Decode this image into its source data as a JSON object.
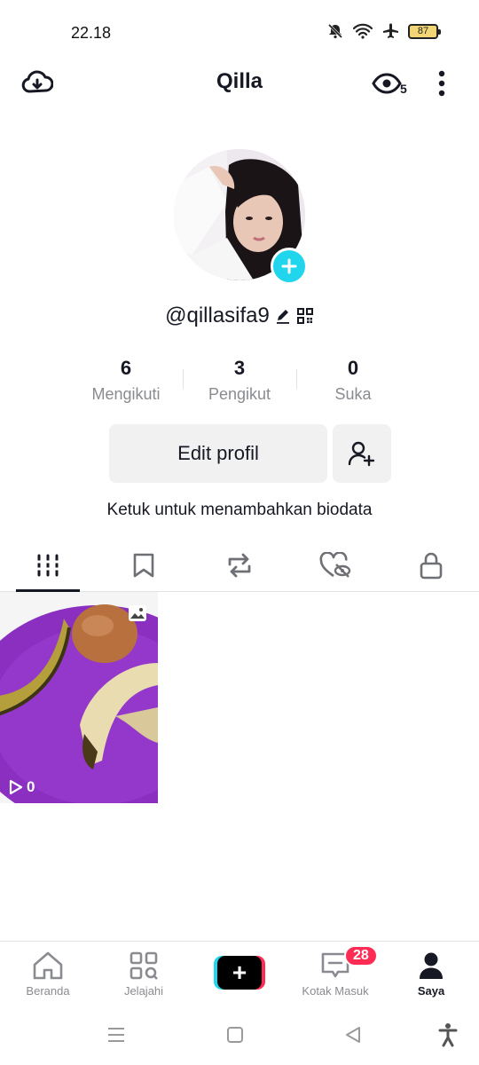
{
  "status_bar": {
    "time": "22.18",
    "battery": "87"
  },
  "header": {
    "title": "Qilla",
    "views_count": "5"
  },
  "profile": {
    "username": "@qillasifa9",
    "stats": [
      {
        "value": "6",
        "label": "Mengikuti"
      },
      {
        "value": "3",
        "label": "Pengikut"
      },
      {
        "value": "0",
        "label": "Suka"
      }
    ],
    "edit_label": "Edit profil",
    "bio_prompt": "Ketuk untuk menambahkan biodata"
  },
  "tabs": [
    "videos-grid-icon",
    "bookmark-icon",
    "repost-icon",
    "liked-hidden-icon",
    "lock-icon"
  ],
  "videos": [
    {
      "views": "0"
    }
  ],
  "bottom_nav": {
    "home": "Beranda",
    "explore": "Jelajahi",
    "inbox": "Kotak Masuk",
    "inbox_badge": "28",
    "profile": "Saya"
  },
  "colors": {
    "accent_cyan": "#20d5ec",
    "accent_red": "#fe2c55",
    "text": "#161823",
    "muted": "#8a8b91"
  }
}
